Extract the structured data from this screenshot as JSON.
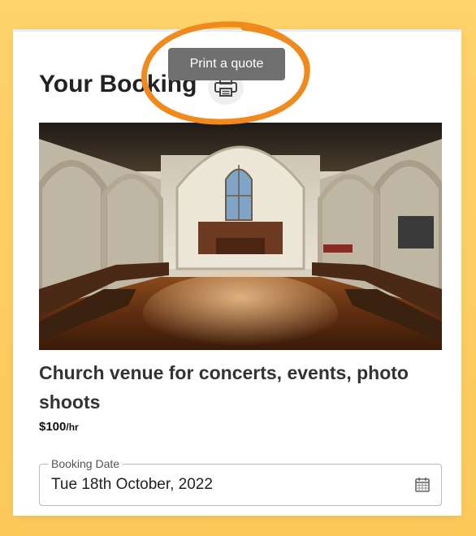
{
  "header": {
    "title": "Your Booking",
    "print_tooltip": "Print a quote",
    "print_icon": "printer-icon"
  },
  "listing": {
    "title": "Church venue for concerts, events, photo shoots",
    "price": "$100",
    "price_unit": "/hr"
  },
  "booking_date": {
    "label": "Booking Date",
    "value": "Tue 18th October, 2022",
    "icon": "calendar-icon"
  },
  "colors": {
    "page_background": "#fcc85a",
    "annotation_stroke": "#f08a1c",
    "tooltip_background": "#6f6f6f"
  }
}
